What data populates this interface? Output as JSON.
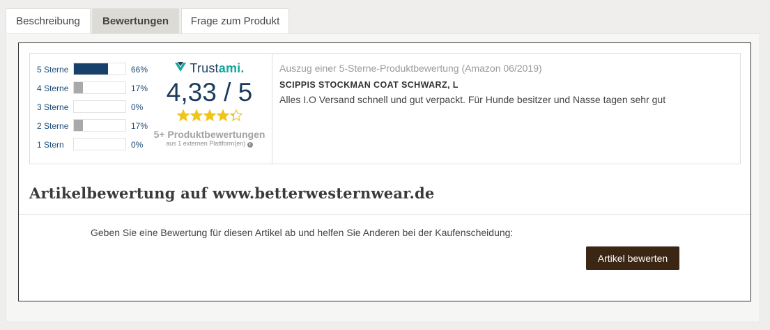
{
  "tabs": [
    {
      "label": "Beschreibung"
    },
    {
      "label": "Bewertungen"
    },
    {
      "label": "Frage zum Produkt"
    }
  ],
  "rating_widget": {
    "distribution": [
      {
        "label": "5 Sterne",
        "percent_text": "66%",
        "fraction": 0.66,
        "color": "#17416a"
      },
      {
        "label": "4 Sterne",
        "percent_text": "17%",
        "fraction": 0.17,
        "color": "#a9a9a9"
      },
      {
        "label": "3 Sterne",
        "percent_text": "0%",
        "fraction": 0.0,
        "color": "#a9a9a9"
      },
      {
        "label": "2 Sterne",
        "percent_text": "17%",
        "fraction": 0.17,
        "color": "#a9a9a9"
      },
      {
        "label": "1 Stern",
        "percent_text": "0%",
        "fraction": 0.0,
        "color": "#a9a9a9"
      }
    ],
    "logo_text_part1": "Trust",
    "logo_text_part2": "ami.",
    "score": "4,33 / 5",
    "stars_value": 4.33,
    "star_color": "#f0c419",
    "reviews_count": "5+ Produktbewertungen",
    "platform_text": "aus 1 externen Plattform(en)"
  },
  "excerpt": {
    "title": "Auszug einer 5-Sterne-Produktbewertung (Amazon 06/2019)",
    "product": "SCIPPIS STOCKMAN COAT SCHWARZ, L",
    "text": "Alles I.O Versand schnell und gut verpackt. Für Hunde besitzer und Nasse tagen sehr gut"
  },
  "section": {
    "title": "Artikelbewertung auf www.betterwesternwear.de",
    "cta_text": "Geben Sie eine Bewertung für diesen Artikel ab und helfen Sie Anderen bei der Kaufenscheidung:",
    "button_label": "Artikel bewerten"
  }
}
